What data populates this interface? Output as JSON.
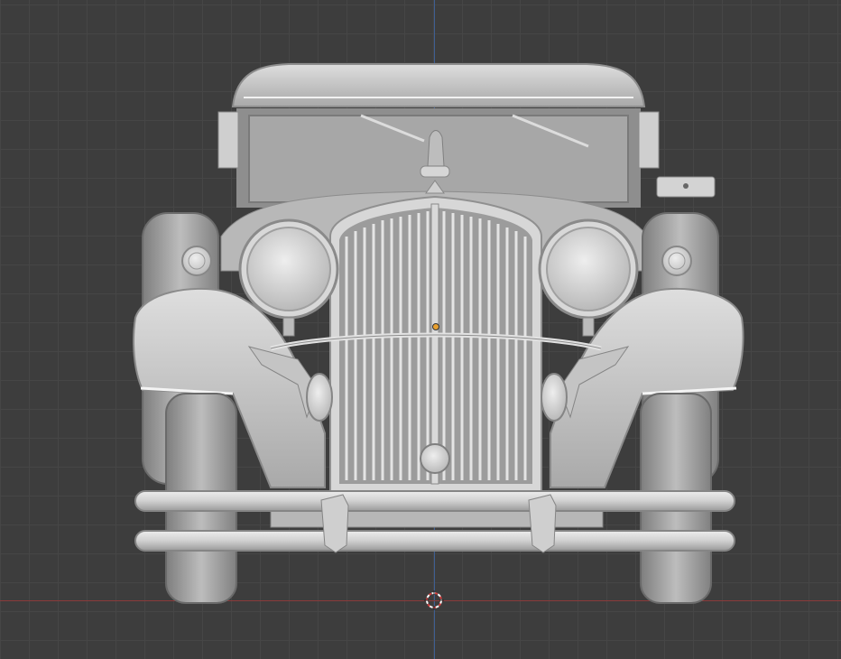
{
  "viewport": {
    "mode": "front-orthographic",
    "background_color": "#3d3d3d",
    "grid_color": "#464646",
    "x_axis_color": "#8a3a3a",
    "y_axis_color": "#3f5f92"
  },
  "scene": {
    "object": "vintage-car-model",
    "material_color": "#c9c9c9",
    "origin_color": "#e8a030"
  },
  "icons": {
    "cursor": "3d-cursor-icon"
  }
}
